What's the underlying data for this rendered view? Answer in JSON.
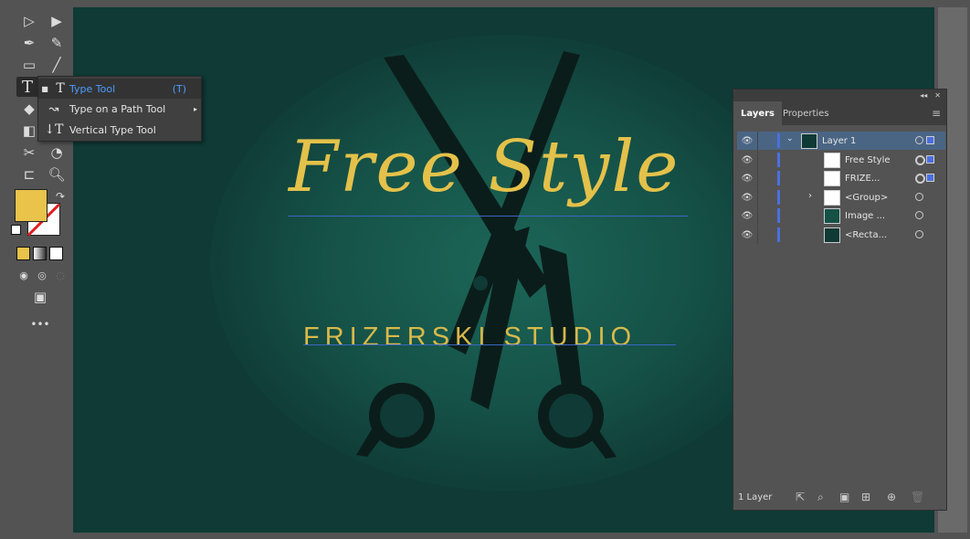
{
  "flyout": {
    "items": [
      {
        "label": "Type Tool",
        "shortcut": "(T)",
        "icon": "type-icon"
      },
      {
        "label": "Type on a Path Tool",
        "icon": "type-on-path-icon"
      },
      {
        "label": "Vertical Type Tool",
        "icon": "vertical-type-icon"
      }
    ]
  },
  "artwork": {
    "title": "Free Style",
    "subtitle": "FRIZERSKI STUDIO"
  },
  "layers_panel": {
    "tabs": [
      "Layers",
      "Properties"
    ],
    "rows": [
      {
        "name": "Layer 1"
      },
      {
        "name": "Free Style"
      },
      {
        "name": "FRIZE..."
      },
      {
        "name": "<Group>"
      },
      {
        "name": "Image ..."
      },
      {
        "name": "<Recta..."
      }
    ],
    "footer_count": "1 Layer"
  },
  "colors": {
    "fill": "#e9c34a",
    "canvas": "#0f3a35",
    "accent": "#4b6fe0"
  }
}
